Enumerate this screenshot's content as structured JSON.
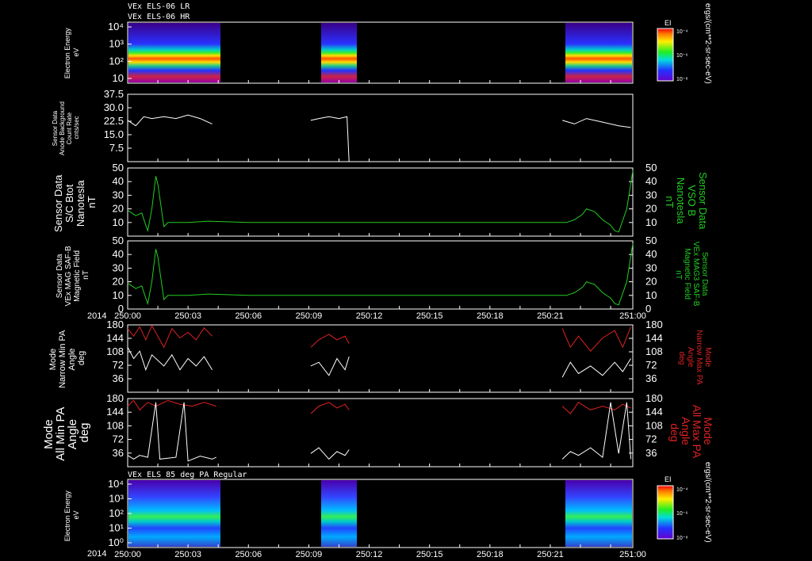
{
  "header": {
    "line1": "VEx ELS-06 LR",
    "line2": "VEx ELS-06 HR"
  },
  "bottom_title": "VEx ELS 85 deg PA Regular",
  "year_label": "2014",
  "colorbar": {
    "title": "EI",
    "ticks": [
      "10⁻⁴",
      "10⁻⁶",
      "10⁻⁸"
    ],
    "unit": "ergs/(cm**2-sr-sec-eV)"
  },
  "chart_data": [
    {
      "type": "heatmap",
      "name": "spectrogram-top",
      "ylabel": [
        "Electron Energy",
        "eV"
      ],
      "ytick_labels": [
        "10⁴",
        "10³",
        "10²",
        "10"
      ],
      "data_intervals": [
        [
          250.0,
          250.04
        ],
        [
          250.09,
          250.11
        ],
        [
          250.21,
          250.25
        ]
      ]
    },
    {
      "type": "line",
      "name": "anode-background",
      "ylabel": [
        "Sensor Data",
        "Anode Background",
        "Count Rate",
        "cnts/sec"
      ],
      "ytick_labels": [
        "37.5",
        "30.0",
        "22.5",
        "15.0",
        "7.5"
      ],
      "ylim": [
        0,
        37.5
      ],
      "series": [
        {
          "color": "#ffffff",
          "segments": [
            [
              [
                0,
                23
              ],
              [
                4,
                20
              ],
              [
                8,
                25
              ],
              [
                12,
                24
              ],
              [
                18,
                25
              ],
              [
                24,
                24
              ],
              [
                30,
                26
              ],
              [
                36,
                24
              ],
              [
                42,
                21
              ]
            ],
            [
              [
                91,
                23
              ],
              [
                95,
                24
              ],
              [
                100,
                25
              ],
              [
                105,
                24
              ],
              [
                109,
                25
              ],
              [
                110,
                0
              ]
            ],
            [
              [
                216,
                23
              ],
              [
                222,
                21
              ],
              [
                228,
                24
              ],
              [
                236,
                22
              ],
              [
                244,
                20
              ],
              [
                250,
                19
              ]
            ]
          ]
        }
      ]
    },
    {
      "type": "line",
      "name": "bmag-vso",
      "ylabel": [
        "Sensor Data",
        "S/C Btot",
        "Nanotesla",
        "nT"
      ],
      "y2label": [
        "Sensor Data",
        "VSO B",
        "Nanotesla",
        "nT"
      ],
      "ytick_labels": [
        "50",
        "40",
        "30",
        "20",
        "10"
      ],
      "ylim": [
        0,
        50
      ],
      "series": [
        {
          "color": "#22cc22",
          "points": [
            [
              0,
              19
            ],
            [
              4,
              15
            ],
            [
              7,
              17
            ],
            [
              9,
              8
            ],
            [
              10,
              4
            ],
            [
              12,
              20
            ],
            [
              14,
              44
            ],
            [
              15,
              38
            ],
            [
              18,
              7
            ],
            [
              20,
              10
            ],
            [
              25,
              10
            ],
            [
              30,
              10
            ],
            [
              40,
              11
            ],
            [
              60,
              10
            ],
            [
              80,
              10
            ],
            [
              100,
              10
            ],
            [
              120,
              10
            ],
            [
              140,
              10
            ],
            [
              160,
              10
            ],
            [
              180,
              10
            ],
            [
              200,
              10
            ],
            [
              218,
              10
            ],
            [
              222,
              12
            ],
            [
              226,
              16
            ],
            [
              228,
              20
            ],
            [
              232,
              18
            ],
            [
              236,
              12
            ],
            [
              240,
              8
            ],
            [
              242,
              4
            ],
            [
              244,
              3
            ],
            [
              248,
              20
            ],
            [
              251,
              48
            ]
          ]
        }
      ]
    },
    {
      "type": "line",
      "name": "bmag-mag",
      "ylabel": [
        "Sensor Data",
        "VEx MAG SAF-B",
        "Magnetic Field",
        "nT"
      ],
      "y2label": [
        "Sensor Data",
        "VEx MAG3 SAF-B",
        "Magnetic Field",
        "nT"
      ],
      "ytick_labels": [
        "50",
        "40",
        "30",
        "20",
        "10",
        "0"
      ],
      "ylim": [
        0,
        50
      ],
      "series": [
        {
          "color": "#22cc22",
          "points": [
            [
              0,
              19
            ],
            [
              4,
              15
            ],
            [
              7,
              17
            ],
            [
              9,
              8
            ],
            [
              10,
              4
            ],
            [
              12,
              20
            ],
            [
              14,
              44
            ],
            [
              15,
              38
            ],
            [
              18,
              7
            ],
            [
              20,
              10
            ],
            [
              25,
              10
            ],
            [
              30,
              10
            ],
            [
              40,
              11
            ],
            [
              60,
              10
            ],
            [
              80,
              10
            ],
            [
              100,
              10
            ],
            [
              120,
              10
            ],
            [
              140,
              10
            ],
            [
              160,
              10
            ],
            [
              180,
              10
            ],
            [
              200,
              10
            ],
            [
              218,
              10
            ],
            [
              222,
              12
            ],
            [
              226,
              16
            ],
            [
              228,
              20
            ],
            [
              232,
              18
            ],
            [
              236,
              12
            ],
            [
              240,
              8
            ],
            [
              242,
              4
            ],
            [
              244,
              3
            ],
            [
              248,
              20
            ],
            [
              251,
              48
            ]
          ]
        }
      ]
    },
    {
      "type": "line",
      "name": "narrow-pa",
      "ylabel": [
        "Mode",
        "Narrow Min PA",
        "Angle",
        "deg"
      ],
      "y2label": [
        "Mode",
        "Narrow Max PA",
        "Angle",
        "deg"
      ],
      "ytick_labels": [
        "180",
        "144",
        "108",
        "72",
        "36"
      ],
      "ylim": [
        0,
        180
      ],
      "series": [
        {
          "color": "#dd2222",
          "segments": [
            [
              [
                0,
                170
              ],
              [
                3,
                150
              ],
              [
                6,
                175
              ],
              [
                9,
                140
              ],
              [
                12,
                178
              ],
              [
                18,
                120
              ],
              [
                22,
                170
              ],
              [
                26,
                145
              ],
              [
                30,
                160
              ],
              [
                34,
                140
              ],
              [
                38,
                172
              ],
              [
                42,
                150
              ]
            ],
            [
              [
                91,
                120
              ],
              [
                95,
                140
              ],
              [
                100,
                155
              ],
              [
                104,
                140
              ],
              [
                108,
                150
              ],
              [
                110,
                130
              ]
            ],
            [
              [
                216,
                170
              ],
              [
                220,
                120
              ],
              [
                224,
                150
              ],
              [
                230,
                110
              ],
              [
                236,
                145
              ],
              [
                242,
                165
              ],
              [
                246,
                120
              ],
              [
                250,
                175
              ]
            ]
          ]
        },
        {
          "color": "#ffffff",
          "segments": [
            [
              [
                0,
                120
              ],
              [
                3,
                90
              ],
              [
                6,
                110
              ],
              [
                9,
                60
              ],
              [
                12,
                100
              ],
              [
                18,
                70
              ],
              [
                22,
                100
              ],
              [
                26,
                60
              ],
              [
                30,
                90
              ],
              [
                34,
                70
              ],
              [
                38,
                95
              ],
              [
                42,
                60
              ]
            ],
            [
              [
                91,
                70
              ],
              [
                95,
                80
              ],
              [
                100,
                45
              ],
              [
                104,
                90
              ],
              [
                108,
                60
              ],
              [
                110,
                95
              ]
            ],
            [
              [
                216,
                40
              ],
              [
                220,
                80
              ],
              [
                224,
                50
              ],
              [
                230,
                70
              ],
              [
                236,
                45
              ],
              [
                242,
                80
              ],
              [
                246,
                55
              ],
              [
                250,
                90
              ]
            ]
          ]
        }
      ]
    },
    {
      "type": "line",
      "name": "all-pa",
      "ylabel": [
        "Mode",
        "All Min PA",
        "Angle",
        "deg"
      ],
      "y2label": [
        "Mode",
        "All Max PA",
        "Angle",
        "deg"
      ],
      "ytick_labels": [
        "180",
        "144",
        "108",
        "72",
        "36"
      ],
      "ylim": [
        0,
        180
      ],
      "series": [
        {
          "color": "#dd2222",
          "segments": [
            [
              [
                0,
                160
              ],
              [
                3,
                175
              ],
              [
                6,
                150
              ],
              [
                10,
                170
              ],
              [
                14,
                160
              ],
              [
                20,
                175
              ],
              [
                26,
                165
              ],
              [
                32,
                160
              ],
              [
                38,
                170
              ],
              [
                44,
                160
              ]
            ],
            [
              [
                91,
                140
              ],
              [
                95,
                160
              ],
              [
                100,
                170
              ],
              [
                104,
                155
              ],
              [
                108,
                165
              ],
              [
                110,
                150
              ]
            ],
            [
              [
                216,
                160
              ],
              [
                220,
                140
              ],
              [
                224,
                170
              ],
              [
                230,
                150
              ],
              [
                236,
                160
              ],
              [
                242,
                150
              ],
              [
                246,
                165
              ],
              [
                250,
                155
              ]
            ]
          ]
        },
        {
          "color": "#ffffff",
          "segments": [
            [
              [
                0,
                30
              ],
              [
                3,
                20
              ],
              [
                6,
                30
              ],
              [
                10,
                25
              ],
              [
                14,
                170
              ],
              [
                16,
                20
              ],
              [
                24,
                25
              ],
              [
                28,
                170
              ],
              [
                30,
                15
              ],
              [
                36,
                28
              ],
              [
                42,
                20
              ],
              [
                44,
                25
              ]
            ],
            [
              [
                91,
                35
              ],
              [
                95,
                50
              ],
              [
                100,
                20
              ],
              [
                104,
                40
              ],
              [
                108,
                30
              ],
              [
                110,
                45
              ]
            ],
            [
              [
                216,
                20
              ],
              [
                220,
                40
              ],
              [
                224,
                30
              ],
              [
                230,
                50
              ],
              [
                236,
                25
              ],
              [
                240,
                170
              ],
              [
                244,
                35
              ],
              [
                248,
                170
              ],
              [
                250,
                20
              ]
            ]
          ]
        }
      ]
    },
    {
      "type": "heatmap",
      "name": "spectrogram-bottom",
      "ylabel": [
        "Electron Energy",
        "eV"
      ],
      "ytick_labels": [
        "10⁴",
        "10³",
        "10²",
        "10¹",
        "10⁰"
      ],
      "x_tick_labels": [
        "250:00",
        "250:03",
        "250:06",
        "250:09",
        "250:12",
        "250:15",
        "250:18",
        "250:21",
        "251:00"
      ],
      "data_intervals": [
        [
          250.0,
          250.04
        ],
        [
          250.09,
          250.11
        ],
        [
          250.21,
          250.25
        ]
      ]
    }
  ]
}
